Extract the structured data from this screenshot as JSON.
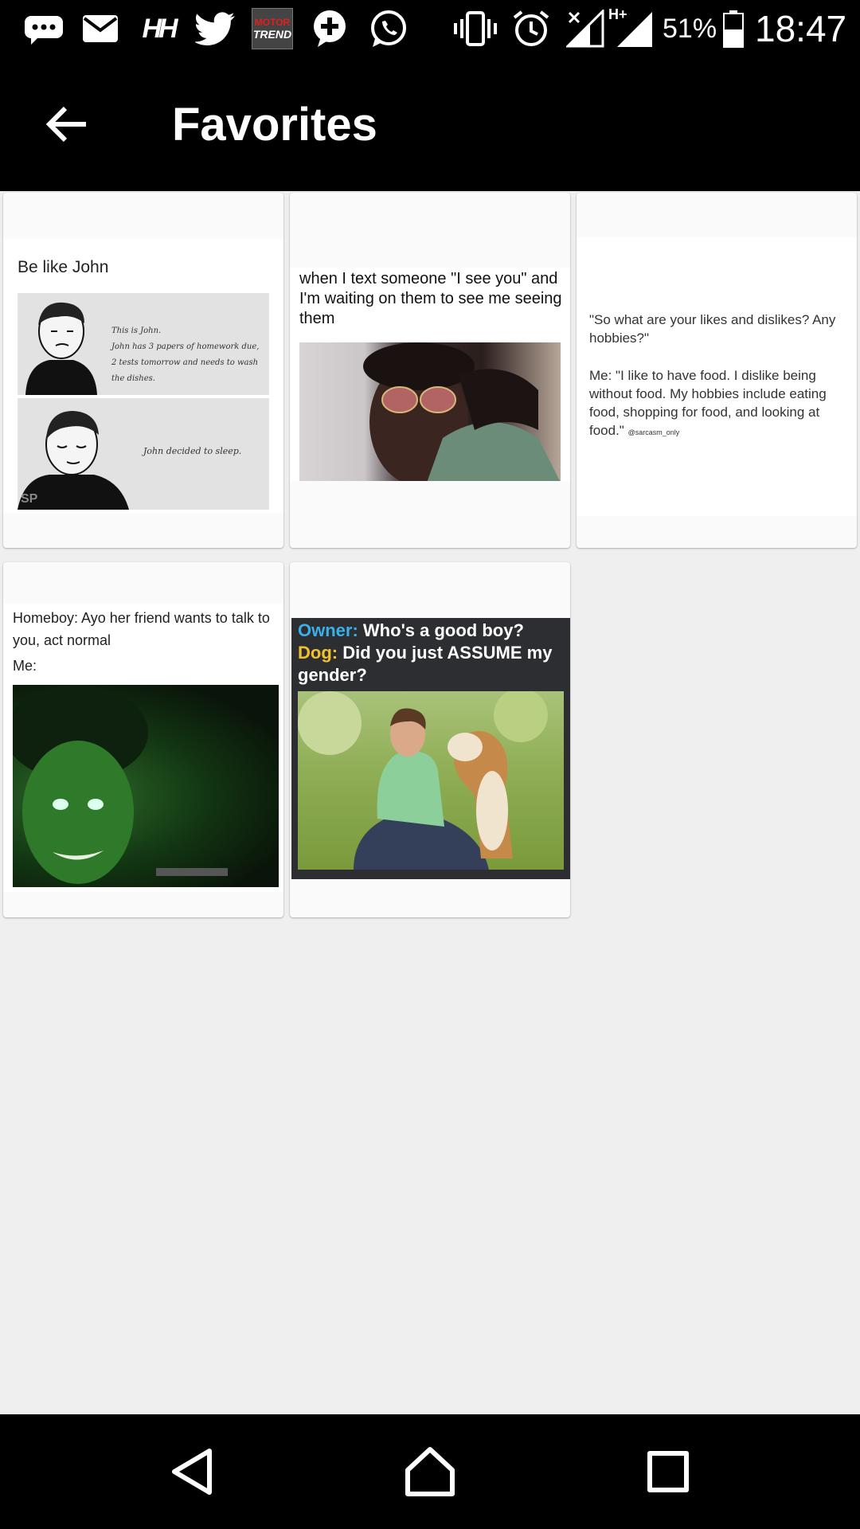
{
  "status_bar": {
    "notification_icons": [
      "messages-icon",
      "mail-icon",
      "hh-app-icon",
      "twitter-icon",
      "motor-trend-icon",
      "chat-plus-icon",
      "whatsapp-icon"
    ],
    "motor_trend_label_top": "MOTOR",
    "motor_trend_label_bottom": "TREND",
    "hh_label": "HH",
    "network_label": "H+",
    "system_icons": [
      "vibrate-icon",
      "alarm-icon",
      "signal-icon",
      "signal-hplus-icon",
      "battery-icon"
    ],
    "battery": "51%",
    "time": "18:47"
  },
  "app_bar": {
    "title": "Favorites"
  },
  "favorites": [
    {
      "caption": "Be like John",
      "panel_1_text": "This is John.",
      "panel_1_text_2": "John has 3 papers of homework due, 2 tests tomorrow and needs to wash the dishes.",
      "panel_2_text": "John decided to sleep.",
      "watermark": "SP"
    },
    {
      "caption": "when I text someone \"I see you\" and I'm waiting on them to see me seeing them"
    },
    {
      "caption_1": "\"So what are your likes and dislikes? Any hobbies?\"",
      "caption_2": "Me: \"I like to have food. I dislike being without food. My hobbies include eating food, shopping for food, and looking at food.\"",
      "credit": "@sarcasm_only"
    },
    {
      "caption_1": "Homeboy: Ayo her friend wants to talk to you, act normal",
      "caption_2": "Me:"
    },
    {
      "owner_label": "Owner:",
      "owner_text": "Who's a good boy?",
      "dog_label": "Dog:",
      "dog_text": "Did you just ASSUME my gender?"
    }
  ],
  "colors": {
    "owner_label": "#3ab0e8",
    "dog_label": "#f2c12e",
    "background": "#efefef",
    "bars": "#000000"
  },
  "nav_bar": {
    "icons": [
      "back-triangle-icon",
      "home-icon",
      "recents-icon"
    ]
  }
}
